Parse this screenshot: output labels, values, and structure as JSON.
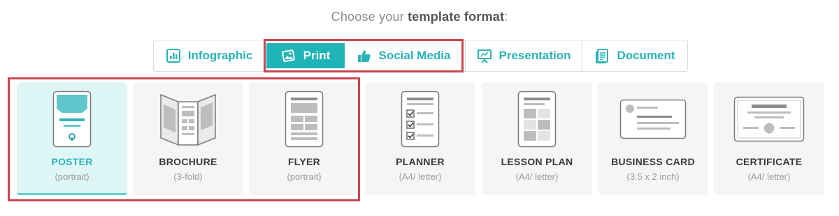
{
  "prompt": {
    "prefix": "Choose your ",
    "bold": "template format",
    "suffix": ":"
  },
  "tabs": [
    {
      "label": "Infographic",
      "icon": "infographic-icon",
      "active": false
    },
    {
      "label": "Print",
      "icon": "print-image-icon",
      "active": true
    },
    {
      "label": "Social Media",
      "icon": "thumbs-up-icon",
      "active": false
    },
    {
      "label": "Presentation",
      "icon": "presentation-board-icon",
      "active": false
    },
    {
      "label": "Document",
      "icon": "document-icon",
      "active": false
    }
  ],
  "cards": [
    {
      "title": "POSTER",
      "sub": "(portrait)",
      "icon": "poster-icon",
      "active": true
    },
    {
      "title": "BROCHURE",
      "sub": "(3-fold)",
      "icon": "brochure-icon",
      "active": false
    },
    {
      "title": "FLYER",
      "sub": "(portrait)",
      "icon": "flyer-icon",
      "active": false
    },
    {
      "title": "PLANNER",
      "sub": "(A4/ letter)",
      "icon": "planner-icon",
      "active": false
    },
    {
      "title": "LESSON PLAN",
      "sub": "(A4/ letter)",
      "icon": "lesson-plan-icon",
      "active": false
    },
    {
      "title": "BUSINESS CARD",
      "sub": "(3.5 x 2 inch)",
      "icon": "business-card-icon",
      "active": false
    },
    {
      "title": "CERTIFICATE",
      "sub": "(A4/ letter)",
      "icon": "certificate-icon",
      "active": false
    }
  ],
  "colors": {
    "accent": "#1fb4b7",
    "accent_text": "#2ab3b8",
    "highlight_border": "#c8474d",
    "active_card_bg": "#dff6f7",
    "card_bg": "#f5f5f5"
  }
}
